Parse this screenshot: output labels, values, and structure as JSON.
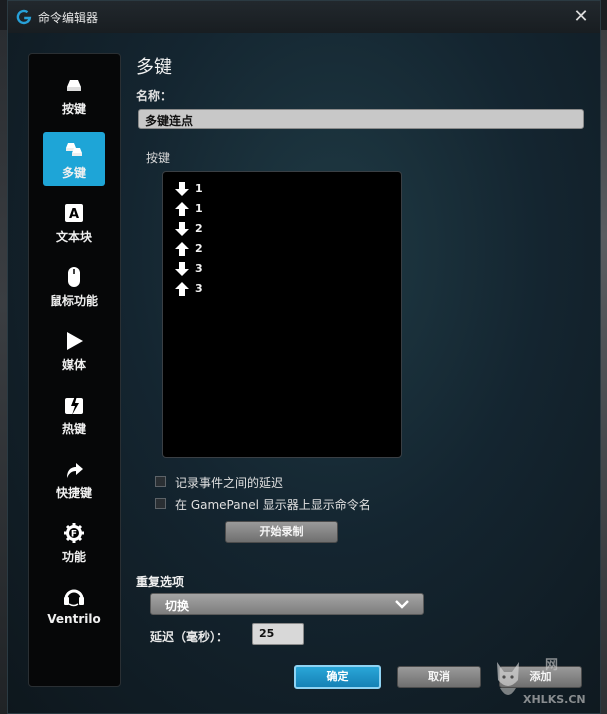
{
  "window": {
    "title": "命令编辑器"
  },
  "sidebar": {
    "items": [
      {
        "label": "按键",
        "icon": "key-icon",
        "active": false
      },
      {
        "label": "多键",
        "icon": "multi-key-icon",
        "active": true
      },
      {
        "label": "文本块",
        "icon": "text-block-icon",
        "active": false
      },
      {
        "label": "鼠标功能",
        "icon": "mouse-icon",
        "active": false
      },
      {
        "label": "媒体",
        "icon": "play-icon",
        "active": false
      },
      {
        "label": "热键",
        "icon": "hotkey-icon",
        "active": false
      },
      {
        "label": "快捷键",
        "icon": "shortcut-arrow-icon",
        "active": false
      },
      {
        "label": "功能",
        "icon": "gear-f-icon",
        "active": false
      },
      {
        "label": "Ventrilo",
        "icon": "headset-icon",
        "active": false
      }
    ]
  },
  "editor": {
    "heading": "多键",
    "name_label": "名称：",
    "name_value": "多键连点",
    "keys_label": "按键",
    "keys": [
      {
        "direction": "down",
        "key": "1"
      },
      {
        "direction": "up",
        "key": "1"
      },
      {
        "direction": "down",
        "key": "2"
      },
      {
        "direction": "up",
        "key": "2"
      },
      {
        "direction": "down",
        "key": "3"
      },
      {
        "direction": "up",
        "key": "3"
      }
    ],
    "record_delay_label": "记录事件之间的延迟",
    "gamepanel_label": "在 GamePanel 显示器上显示命令名",
    "start_record_label": "开始录制",
    "repeat_label": "重复选项",
    "repeat_value": "切换",
    "delay_label": "延迟（毫秒）：",
    "delay_value": "25"
  },
  "footer": {
    "ok_label": "确定",
    "cancel_label": "取消",
    "add_label": "添加"
  },
  "watermark": {
    "site": "XHLKS.CN",
    "cn": "网"
  },
  "colors": {
    "accent": "#1ea5d7",
    "background": "#142530"
  }
}
